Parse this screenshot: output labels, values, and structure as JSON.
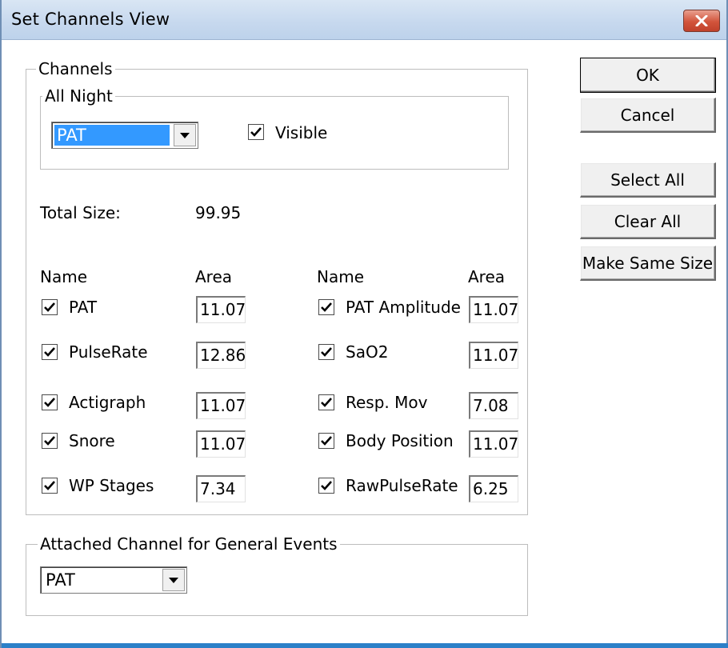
{
  "window": {
    "title": "Set Channels View"
  },
  "channels_group": {
    "label": "Channels",
    "all_night": {
      "label": "All Night",
      "channel_select_value": "PAT",
      "visible_label": "Visible",
      "visible_checked": true
    },
    "total_size_label": "Total Size:",
    "total_size_value": "99.95",
    "headers": {
      "name": "Name",
      "area": "Area"
    },
    "left_channels": [
      {
        "name": "PAT",
        "area": "11.07",
        "checked": true
      },
      {
        "name": "PulseRate",
        "area": "12.86",
        "checked": true
      },
      {
        "name": "Actigraph",
        "area": "11.07",
        "checked": true
      },
      {
        "name": "Snore",
        "area": "11.07",
        "checked": true
      },
      {
        "name": "WP Stages",
        "area": "7.34",
        "checked": true
      }
    ],
    "right_channels": [
      {
        "name": "PAT Amplitude",
        "area": "11.07",
        "checked": true
      },
      {
        "name": "SaO2",
        "area": "11.07",
        "checked": true
      },
      {
        "name": "Resp. Mov",
        "area": "7.08",
        "checked": true
      },
      {
        "name": "Body Position",
        "area": "11.07",
        "checked": true
      },
      {
        "name": "RawPulseRate",
        "area": "6.25",
        "checked": true
      }
    ]
  },
  "general_events_group": {
    "label": "Attached Channel for General Events",
    "channel_select_value": "PAT"
  },
  "buttons": {
    "ok": "OK",
    "cancel": "Cancel",
    "select_all": "Select All",
    "clear_all": "Clear All",
    "make_same_size": "Make Same Size"
  },
  "icons": {
    "close": "close-icon",
    "dropdown": "chevron-down-icon",
    "check": "checkmark-icon"
  },
  "colors": {
    "selection": "#3399ff",
    "close_button": "#c94a32",
    "titlebar": "#c6d8ee"
  }
}
